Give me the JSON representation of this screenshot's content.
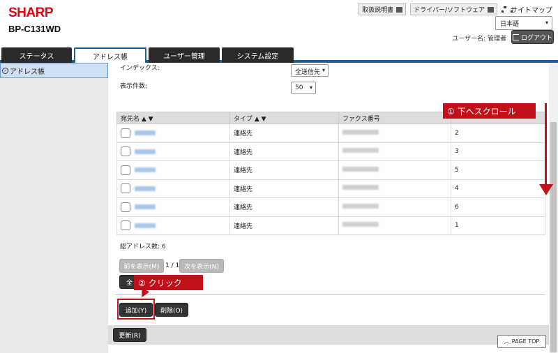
{
  "header": {
    "logo": "SHARP",
    "model": "BP-C131WD",
    "links": [
      {
        "label": "取扱説明書"
      },
      {
        "label": "ドライバー/ソフトウェア"
      }
    ],
    "sitemap": "サイトマップ",
    "language": "日本語",
    "user_label": "ユーザー名: 管理者",
    "logout": "ログアウト"
  },
  "tabs": [
    {
      "label": "ステータス"
    },
    {
      "label": "アドレス帳"
    },
    {
      "label": "ユーザー管理"
    },
    {
      "label": "システム設定"
    }
  ],
  "sidebar": {
    "item": "アドレス帳"
  },
  "filters": {
    "index_label": "インデックス:",
    "index_value": "全送信先",
    "count_label": "表示件数:",
    "count_value": "50"
  },
  "table": {
    "headers": [
      "宛先名 ▲ ▼",
      "タイプ ▲ ▼",
      "ファクス番号",
      ""
    ],
    "rows": [
      {
        "type": "連絡先",
        "num": "2"
      },
      {
        "type": "連絡先",
        "num": "3"
      },
      {
        "type": "連絡先",
        "num": "5"
      },
      {
        "type": "連絡先",
        "num": "4"
      },
      {
        "type": "連絡先",
        "num": "6"
      },
      {
        "type": "連絡先",
        "num": "1"
      }
    ]
  },
  "total": "総アドレス数: 6",
  "pager": {
    "prev": "前を表示(M)",
    "page": "1 / 1",
    "next": "次を表示(N)",
    "select_all": "全"
  },
  "actions": {
    "add": "追加(Y)",
    "delete": "削除(O)",
    "refresh": "更新(R)",
    "page_top": "PAGE TOP"
  },
  "annotations": {
    "step1": "① 下へスクロール",
    "step2": "② クリック"
  },
  "colors": {
    "accent": "#1e5f99",
    "annotation": "#c1101a",
    "brand": "#e60012"
  }
}
